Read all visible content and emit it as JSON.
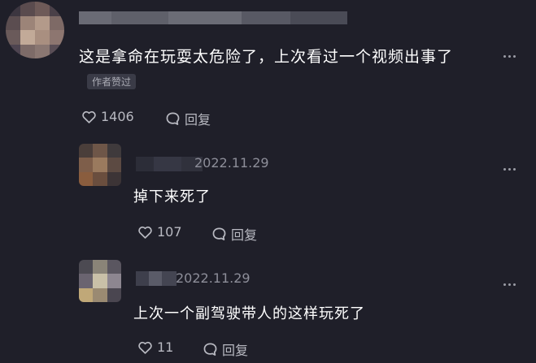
{
  "comment": {
    "text": "这是拿命在玩耍太危险了，上次看过一个视频出事了",
    "badge": "作者赞过",
    "likes": "1406",
    "reply_label": "回复",
    "avatar_icon": "blurred-avatar",
    "more_icon": "more-dots-icon"
  },
  "replies": [
    {
      "date": "2022.11.29",
      "text": "掉下来死了",
      "likes": "107",
      "reply_label": "回复"
    },
    {
      "date": "2022.11.29",
      "text": "上次一个副驾驶带人的这样玩死了",
      "likes": "11",
      "reply_label": "回复"
    }
  ],
  "colors": {
    "background": "#1f1f29",
    "text": "#ffffff",
    "muted": "#8d8e99",
    "action": "#b8b9c1"
  }
}
